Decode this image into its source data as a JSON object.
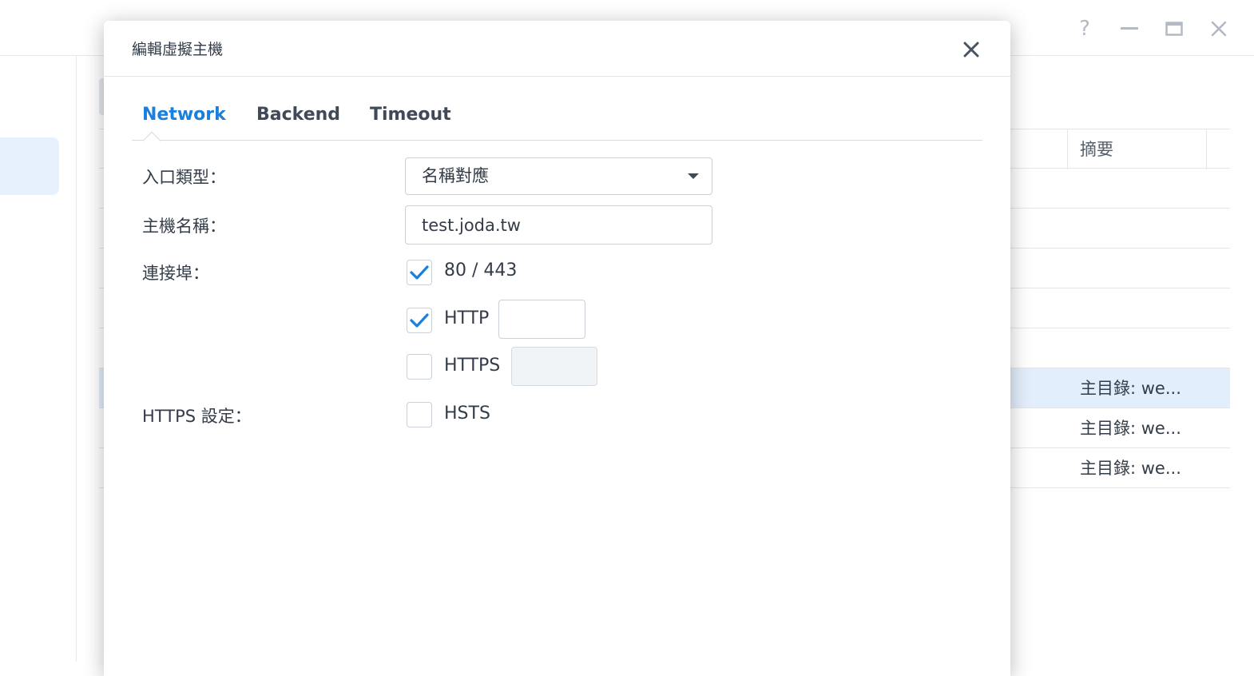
{
  "window": {
    "controls": [
      {
        "name": "help-icon",
        "glyph": "?"
      },
      {
        "name": "minimize-icon"
      },
      {
        "name": "maximize-icon"
      },
      {
        "name": "close-icon"
      }
    ]
  },
  "background_table": {
    "header_summary": "摘要",
    "rows": [
      {
        "summary": "",
        "selected": false
      },
      {
        "summary": "",
        "selected": false
      },
      {
        "summary": "",
        "selected": false
      },
      {
        "summary": "",
        "selected": false
      },
      {
        "summary": "",
        "selected": false
      },
      {
        "summary": "主目錄: we...",
        "selected": true
      },
      {
        "summary": "主目錄: we...",
        "selected": false
      },
      {
        "summary": "主目錄: we...",
        "selected": false
      }
    ]
  },
  "dialog": {
    "title": "編輯虛擬主機",
    "tabs": [
      {
        "label": "Network",
        "active": true
      },
      {
        "label": "Backend",
        "active": false
      },
      {
        "label": "Timeout",
        "active": false
      }
    ],
    "form": {
      "entry_type": {
        "label": "入口類型：",
        "value": "名稱對應"
      },
      "hostname": {
        "label": "主機名稱：",
        "value": "test.joda.tw"
      },
      "port": {
        "label": "連接埠：",
        "options": [
          {
            "label": "80 / 443",
            "checked": true
          },
          {
            "label": "HTTP",
            "checked": true,
            "port_value": ""
          },
          {
            "label": "HTTPS",
            "checked": false,
            "port_value": ""
          }
        ]
      },
      "https_settings": {
        "label": "HTTPS 設定：",
        "hsts": {
          "label": "HSTS",
          "checked": false
        }
      }
    }
  },
  "colors": {
    "accent": "#1b7fdc",
    "selected_row": "#e3eefc",
    "border": "#c9d0d8",
    "text": "#333c48"
  }
}
